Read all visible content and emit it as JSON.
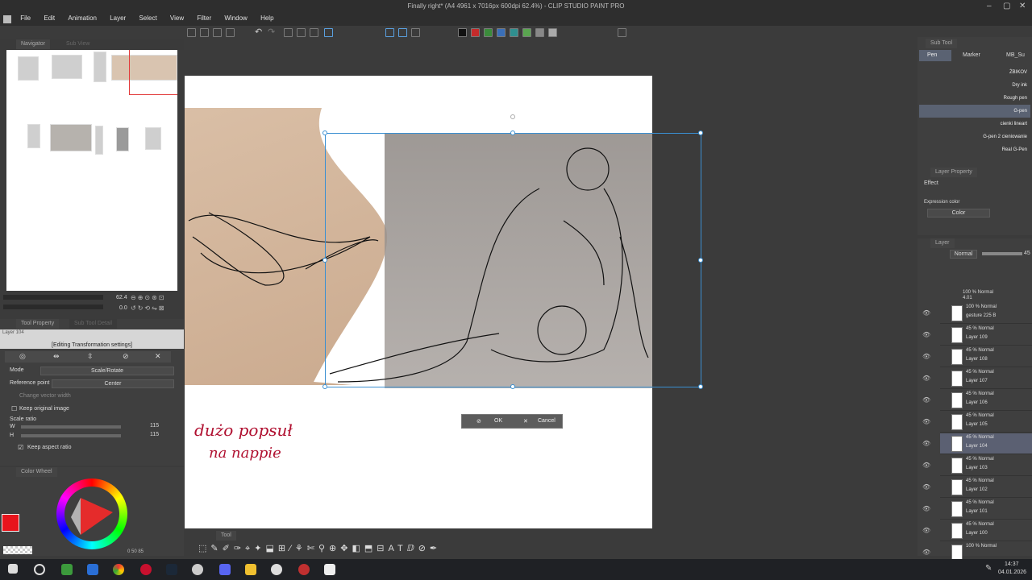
{
  "window": {
    "title": "Finally right* (A4 4961 x 7016px 600dpi 62.4%) - CLIP STUDIO PAINT PRO"
  },
  "menu": [
    "File",
    "Edit",
    "Animation",
    "Layer",
    "Select",
    "View",
    "Filter",
    "Window",
    "Help"
  ],
  "navigator": {
    "tab": "Navigator",
    "tab2": "Sub View",
    "zoom": "62.4",
    "rotation": "0.0"
  },
  "tool_property": {
    "tab": "Tool Property",
    "tab2": "Sub Tool Detail",
    "layer_name": "Layer 104",
    "heading": "[Editing Transformation settings]",
    "mode_label": "Mode",
    "mode_value": "Scale/Rotate",
    "ref_label": "Reference point",
    "ref_value": "Center",
    "change_vector": "Change vector width",
    "keep_original": "Keep original image",
    "scale_ratio": "Scale ratio",
    "w_label": "W",
    "w_value": "115",
    "h_label": "H",
    "h_value": "115",
    "keep_aspect": "Keep aspect ratio"
  },
  "color_wheel": {
    "tab": "Color Wheel",
    "values": "0  50  85",
    "main_color": "#e8141c"
  },
  "subtool": {
    "tab": "Sub Tool",
    "groups": [
      "Pen",
      "Marker",
      "MB_Su"
    ],
    "brushes": [
      "ŻBIKOV",
      "Dry ink",
      "Rough pen",
      "G-pen",
      "cienki lineart",
      "G-pen 2 cieniowanie",
      "Real G-Pen"
    ],
    "active_index": 3
  },
  "layer_property": {
    "tab": "Layer Property",
    "effect": "Effect",
    "expression_label": "Expression color",
    "expression_value": "Color"
  },
  "layer_panel": {
    "tab": "Layer",
    "blend": "Normal",
    "opacity": "45",
    "folder": {
      "mode": "100 % Normal",
      "name": "4.01"
    },
    "layers": [
      {
        "mode": "100 % Normal",
        "name": "gesture 225 B"
      },
      {
        "mode": "45 % Normal",
        "name": "Layer 109"
      },
      {
        "mode": "45 % Normal",
        "name": "Layer 108"
      },
      {
        "mode": "45 % Normal",
        "name": "Layer 107"
      },
      {
        "mode": "45 % Normal",
        "name": "Layer 106"
      },
      {
        "mode": "45 % Normal",
        "name": "Layer 105"
      },
      {
        "mode": "45 % Normal",
        "name": "Layer 104"
      },
      {
        "mode": "45 % Normal",
        "name": "Layer 103"
      },
      {
        "mode": "45 % Normal",
        "name": "Layer 102"
      },
      {
        "mode": "45 % Normal",
        "name": "Layer 101"
      },
      {
        "mode": "45 % Normal",
        "name": "Layer 100"
      },
      {
        "mode": "100 % Normal",
        "name": ""
      }
    ],
    "active_index": 6
  },
  "canvas": {
    "note_line1": "dużo popsuł",
    "note_line2": "na nappie"
  },
  "dialog": {
    "ok": "OK",
    "cancel": "Cancel"
  },
  "bottom_tools": {
    "tab": "Tool"
  },
  "taskbar": {
    "time": "14:37",
    "date": "04.01.2026"
  }
}
